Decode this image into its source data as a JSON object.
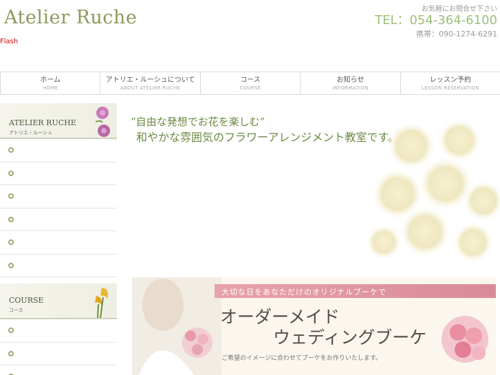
{
  "header": {
    "logo": "Atelier Ruche",
    "contact_note": "お気軽にお問合せ下さい",
    "tel": "TEL：054-364-6100",
    "mobile": "携帯：090-1274-6291"
  },
  "flash_notice": {
    "line1": "Flash",
    "line2": "",
    "line3": ""
  },
  "nav": [
    {
      "jp": "ホーム",
      "en": "HOME"
    },
    {
      "jp": "アトリエ・ルーシュについて",
      "en": "ABOUT ATELIER RUCHE"
    },
    {
      "jp": "コース",
      "en": "COURSE"
    },
    {
      "jp": "お知らせ",
      "en": "INFORMATION"
    },
    {
      "jp": "レッスン予約",
      "en": "LESSON RESERVATION"
    }
  ],
  "sidebar1": {
    "title": "ATELIER RUCHE",
    "subtitle": "アトリエ・ルーシュ",
    "items": [
      "",
      "",
      "",
      "",
      "",
      ""
    ]
  },
  "sidebar2": {
    "title": "COURSE",
    "subtitle": "コース",
    "items": [
      "",
      "",
      ""
    ]
  },
  "main": {
    "headline1": "“自由な発想でお花を楽しむ”",
    "headline2": "和やかな雰囲気のフラワーアレンジメント教室です。",
    "paragraph": [
      "",
      "",
      "",
      "",
      "",
      ""
    ]
  },
  "banner": {
    "stripe": "大切な日をあなただけのオリジナルブーケで",
    "title1": "オーダーメイド",
    "title2": "ウェディングブーケ",
    "subtitle": "ご希望のイメージに合わせてブーケをお作りいたします。"
  },
  "colors": {
    "accent_green": "#98ad72",
    "title_green": "#6a8a40",
    "banner_pink": "#e7a2aa"
  }
}
